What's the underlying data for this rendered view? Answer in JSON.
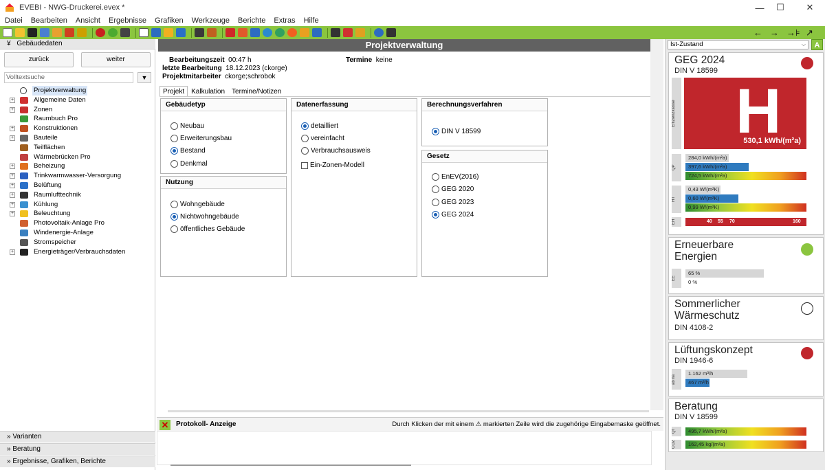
{
  "window": {
    "title": "EVEBI - NWG-Druckerei.evex *",
    "app_icon": "house-icon",
    "controls": [
      "—",
      "☐",
      "✕"
    ]
  },
  "menu": [
    "Datei",
    "Bearbeiten",
    "Ansicht",
    "Ergebnisse",
    "Grafiken",
    "Werkzeuge",
    "Berichte",
    "Extras",
    "Hilfe"
  ],
  "toolbar": {
    "accent": "#8bc53f",
    "right_icons": [
      "←",
      "→",
      "→⊧",
      "↗"
    ]
  },
  "left": {
    "header": "Gebäudedaten",
    "header_icon": "double-chevron-down-icon",
    "back_label": "zurück",
    "forward_label": "weiter",
    "search_placeholder": "Volltextsuche",
    "filter_icon": "filter-icon",
    "tree": [
      {
        "label": "Projektverwaltung",
        "icon": "clock-icon",
        "expandable": false,
        "selected": true
      },
      {
        "label": "Allgemeine Daten",
        "icon": "house-icon",
        "expandable": true
      },
      {
        "label": "Zonen",
        "icon": "zones-icon",
        "expandable": true
      },
      {
        "label": "Raumbuch Pro",
        "icon": "roombook-icon",
        "expandable": false
      },
      {
        "label": "Konstruktionen",
        "icon": "wall-icon",
        "expandable": true
      },
      {
        "label": "Bauteile",
        "icon": "building-part-icon",
        "expandable": true
      },
      {
        "label": "Teilflächen",
        "icon": "surface-icon",
        "expandable": false
      },
      {
        "label": "Wärmebrücken Pro",
        "icon": "thermal-bridge-icon",
        "expandable": false
      },
      {
        "label": "Beheizung",
        "icon": "heating-icon",
        "expandable": true
      },
      {
        "label": "Trinkwarmwasser-Versorgung",
        "icon": "water-drop-icon",
        "expandable": true
      },
      {
        "label": "Belüftung",
        "icon": "fan-icon",
        "expandable": true
      },
      {
        "label": "Raumlufttechnik",
        "icon": "air-handling-icon",
        "expandable": true
      },
      {
        "label": "Kühlung",
        "icon": "snowflake-icon",
        "expandable": true
      },
      {
        "label": "Beleuchtung",
        "icon": "bulb-icon",
        "expandable": true
      },
      {
        "label": "Photovoltaik-Anlage Pro",
        "icon": "pv-icon",
        "expandable": false
      },
      {
        "label": "Windenergie-Anlage",
        "icon": "wind-icon",
        "expandable": false
      },
      {
        "label": "Stromspeicher",
        "icon": "battery-icon",
        "expandable": false
      },
      {
        "label": "Energieträger/Verbrauchsdaten",
        "icon": "plug-icon",
        "expandable": true
      }
    ],
    "bottom": [
      "Varianten",
      "Beratung",
      "Ergebnisse, Grafiken, Berichte"
    ]
  },
  "main": {
    "title": "Projektverwaltung",
    "info": {
      "bearbeitungszeit_label": "Bearbeitungszeit",
      "bearbeitungszeit": "00:47 h",
      "letzte_label": "letzte Bearbeitung",
      "letzte": "18.12.2023 (ckorge)",
      "mitarbeiter_label": "Projektmitarbeiter",
      "mitarbeiter": "ckorge;schrobok",
      "termine_label": "Termine",
      "termine": "keine"
    },
    "tabs": [
      "Projekt",
      "Kalkulation",
      "Termine/Notizen"
    ],
    "active_tab": "Projekt",
    "gebaeudetyp": {
      "title": "Gebäudetyp",
      "options": [
        "Neubau",
        "Erweiterungsbau",
        "Bestand",
        "Denkmal"
      ],
      "selected": "Bestand"
    },
    "nutzung": {
      "title": "Nutzung",
      "options": [
        "Wohngebäude",
        "Nichtwohngebäude",
        "öffentliches Gebäude"
      ],
      "selected": "Nichtwohngebäude"
    },
    "datenerfassung": {
      "title": "Datenerfassung",
      "options": [
        "detailliert",
        "vereinfacht",
        "Verbrauchsausweis"
      ],
      "selected": "detailliert",
      "checkbox": "Ein-Zonen-Modell",
      "checkbox_checked": false
    },
    "berechnung": {
      "title": "Berechnungsverfahren",
      "options": [
        "DIN V 18599"
      ],
      "selected": "DIN V 18599"
    },
    "gesetz": {
      "title": "Gesetz",
      "options": [
        "EnEV(2016)",
        "GEG 2020",
        "GEG 2023",
        "GEG 2024"
      ],
      "selected": "GEG 2024"
    },
    "protokoll": {
      "title": "Protokoll- Anzeige",
      "close_icon": "close-icon",
      "hint": "Durch Klicken der mit einem ⚠ markierten Zeile wird die zugehörige Eingabemaske geöffnet."
    }
  },
  "right": {
    "select_value": "Ist-Zustand",
    "a_button": "A",
    "geg": {
      "title": "GEG 2024",
      "sub": "DIN V 18599",
      "status_color": "#c0262c",
      "efficiency_label": "Effizienzklasse",
      "class": "H",
      "big_value": "530,1 kWh/(m²a)",
      "qp_label": "QP",
      "qp": [
        {
          "text": "284,0 kWh/(m²a)",
          "fill": 0.36
        },
        {
          "text": "397,6 kWh/(m²a)",
          "fill": 0.52
        },
        {
          "text": "724,5 kWh/(m²a)",
          "fill": 1.0
        }
      ],
      "ht_label": "HT",
      "ht": [
        {
          "text": "0,43 W/(m²K)",
          "fill": 0.29
        },
        {
          "text": "0,60 W/(m²K)",
          "fill": 0.44
        },
        {
          "text": "0,99 W/(m²K)",
          "fill": 1.0
        }
      ],
      "eh_label": "EH",
      "eh": [
        "40",
        "55",
        "70",
        "160"
      ]
    },
    "ee": {
      "title_line1": "Erneuerbare",
      "title_line2": "Energien",
      "status_color": "#8bc53f",
      "label": "EE",
      "bars": [
        {
          "text": "65 %",
          "fill": 0.65
        },
        {
          "text": "0 %",
          "fill": 0
        }
      ]
    },
    "sommer": {
      "title_line1": "Sommerlicher",
      "title_line2": "Wärmeschutz",
      "sub": "DIN 4108-2",
      "status_color": "#ffffff"
    },
    "lueftung": {
      "title": "Lüftungskonzept",
      "sub": "DIN 1946-6",
      "status_color": "#c0262c",
      "label": "ab na",
      "bars": [
        {
          "text": "1.162 m³/h",
          "fill": 0.51
        },
        {
          "text": "467 m³/h",
          "fill": 0.2
        }
      ]
    },
    "beratung": {
      "title": "Beratung",
      "sub": "DIN V 18599",
      "bars": [
        {
          "label": "Qf",
          "text": "495,7 kWh/(m²a)",
          "fill": 1.0
        },
        {
          "label": "CO2",
          "text": "162,45 kg/(m²a)",
          "fill": 1.0
        }
      ]
    }
  }
}
